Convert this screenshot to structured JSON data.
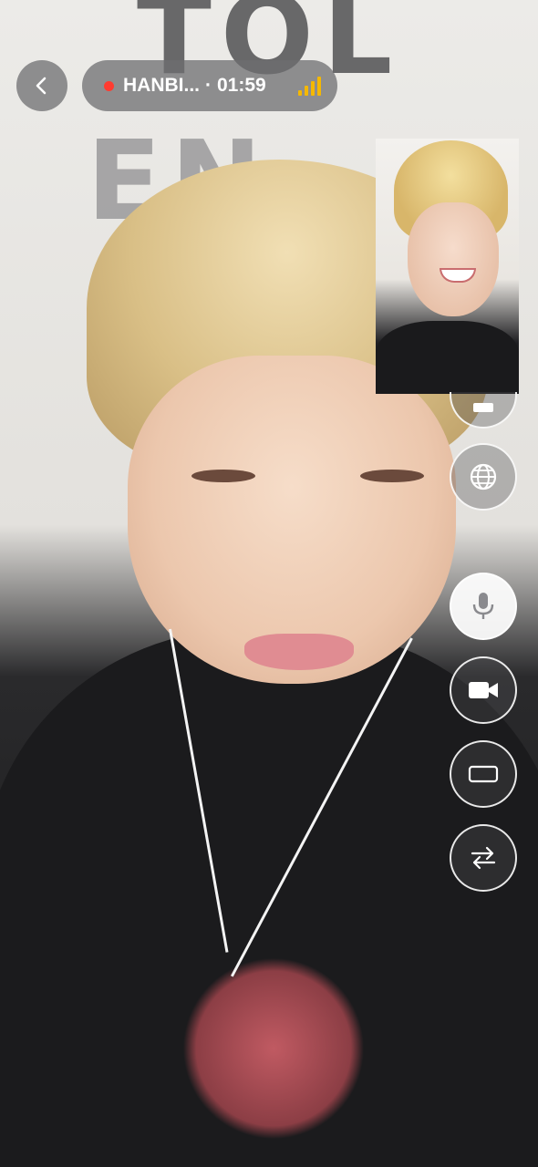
{
  "call": {
    "caller_name": "HANBI...",
    "separator": "·",
    "duration": "01:59",
    "recording": true,
    "signal_bars": 4,
    "signal_color": "#f5b800",
    "recording_dot_color": "#ff3b30"
  },
  "background_text": {
    "row1": "TOL",
    "row2": "EN"
  },
  "controls": [
    {
      "name": "partial-control-icon",
      "state": "partially-hidden"
    },
    {
      "name": "globe-icon",
      "state": "default"
    },
    {
      "name": "microphone-icon",
      "state": "active"
    },
    {
      "name": "video-camera-icon",
      "state": "default"
    },
    {
      "name": "screen-rectangle-icon",
      "state": "default"
    },
    {
      "name": "swap-camera-icon",
      "state": "default"
    }
  ]
}
